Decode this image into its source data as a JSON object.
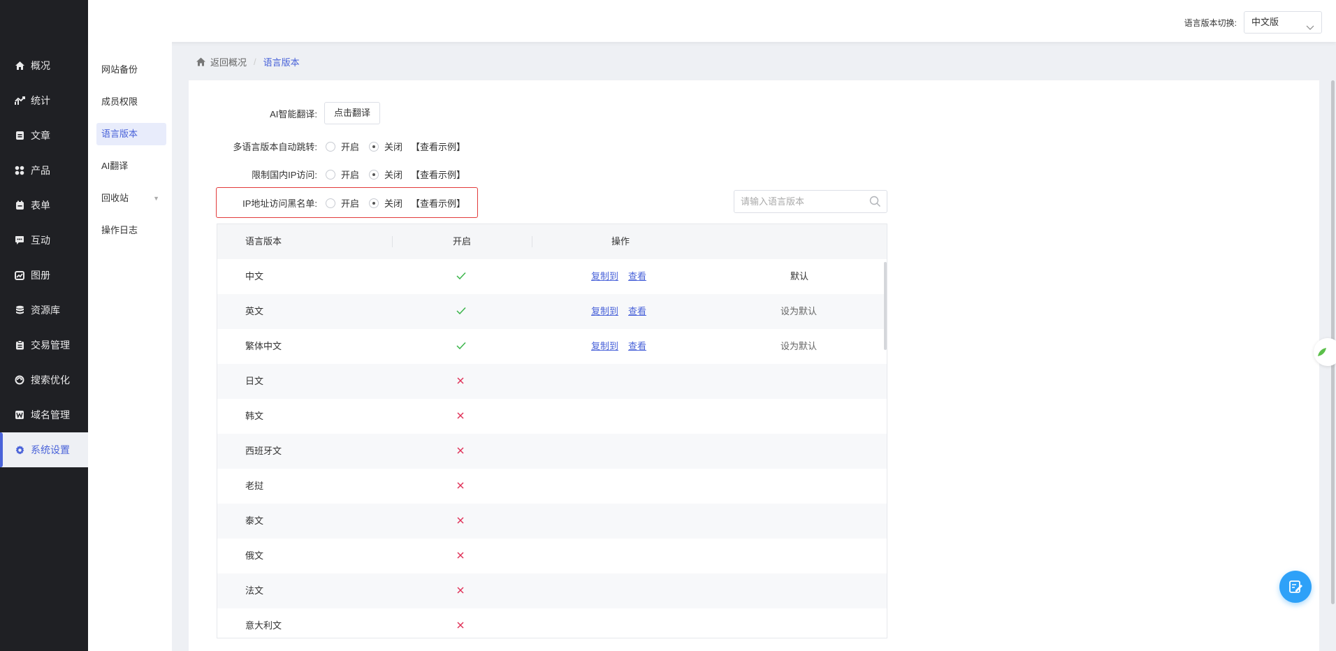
{
  "sidebar": {
    "items": [
      {
        "label": "概况",
        "icon": "home-icon"
      },
      {
        "label": "统计",
        "icon": "chart-icon"
      },
      {
        "label": "文章",
        "icon": "article-icon"
      },
      {
        "label": "产品",
        "icon": "grid-icon"
      },
      {
        "label": "表单",
        "icon": "form-icon"
      },
      {
        "label": "互动",
        "icon": "chat-icon"
      },
      {
        "label": "图册",
        "icon": "gallery-icon"
      },
      {
        "label": "资源库",
        "icon": "database-icon"
      },
      {
        "label": "交易管理",
        "icon": "clipboard-icon"
      },
      {
        "label": "搜索优化",
        "icon": "seo-icon"
      },
      {
        "label": "域名管理",
        "icon": "domain-icon"
      },
      {
        "label": "系统设置",
        "icon": "gear-icon"
      }
    ],
    "active_index": 11
  },
  "topbar": {
    "lang_switch_label": "语言版本切换:",
    "lang_selected": "中文版"
  },
  "subnav": {
    "items": [
      "网站备份",
      "成员权限",
      "语言版本",
      "AI翻译",
      "回收站",
      "操作日志"
    ],
    "active": "语言版本"
  },
  "breadcrumb": {
    "back": "返回概况",
    "current": "语言版本"
  },
  "settings": {
    "ai_label": "AI智能翻译:",
    "ai_button": "点击翻译",
    "auto_jump_label": "多语言版本自动跳转:",
    "domestic_ip_label": "限制国内IP访问:",
    "ip_blacklist_label": "IP地址访问黑名单:",
    "on": "开启",
    "off": "关闭",
    "example": "【查看示例】"
  },
  "search": {
    "placeholder": "请输入语言版本"
  },
  "table": {
    "headers": {
      "lang": "语言版本",
      "enabled": "开启",
      "ops": "操作"
    },
    "copy_label": "复制到",
    "view_label": "查看",
    "default_label": "默认",
    "set_default_label": "设为默认",
    "rows": [
      {
        "lang": "中文",
        "enabled": true,
        "default": true
      },
      {
        "lang": "英文",
        "enabled": true,
        "default": false
      },
      {
        "lang": "繁体中文",
        "enabled": true,
        "default": false
      },
      {
        "lang": "日文",
        "enabled": false
      },
      {
        "lang": "韩文",
        "enabled": false
      },
      {
        "lang": "西班牙文",
        "enabled": false
      },
      {
        "lang": "老挝",
        "enabled": false
      },
      {
        "lang": "泰文",
        "enabled": false
      },
      {
        "lang": "俄文",
        "enabled": false
      },
      {
        "lang": "法文",
        "enabled": false
      },
      {
        "lang": "意大利文",
        "enabled": false
      }
    ]
  },
  "colors": {
    "accent": "#4a63d9",
    "check": "#3bb54a",
    "cross": "#e0345a",
    "sidebar_bg": "#1f2024",
    "highlight": "#e23b3b",
    "float_btn": "#2ea1f8"
  }
}
